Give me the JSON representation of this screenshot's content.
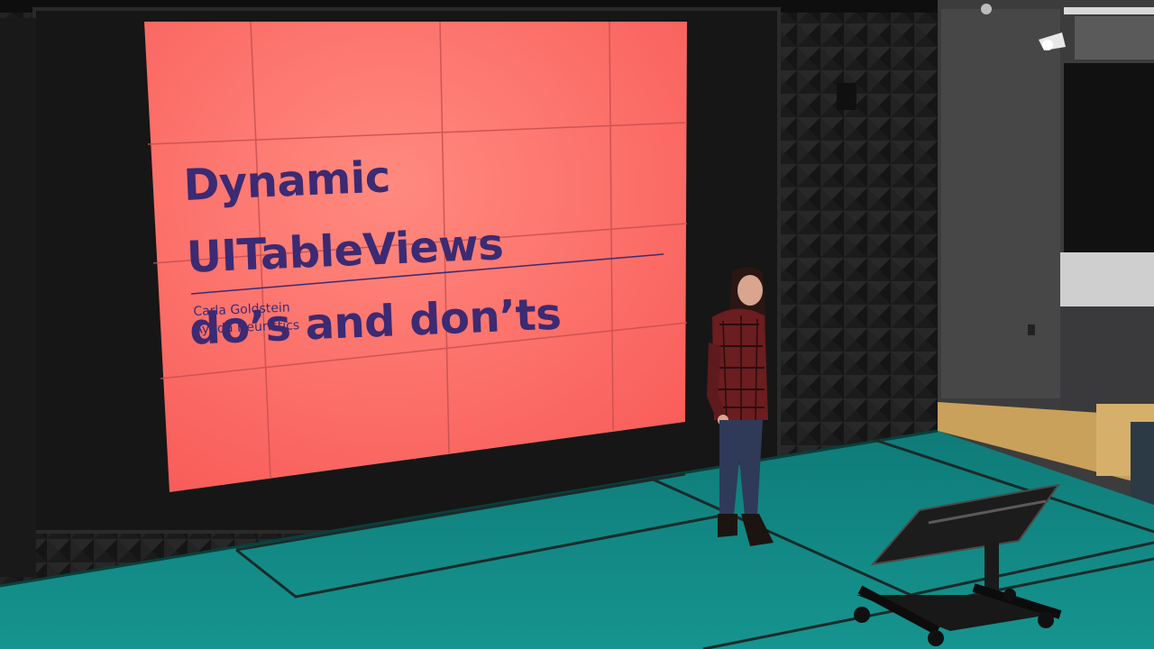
{
  "slide": {
    "title_line1": "Dynamic UITableViews",
    "title_line2": "do’s and don’ts",
    "author": "Carla Goldstein",
    "company": "Ayuda Heuristics"
  },
  "colors": {
    "slide_background": "#fb6c67",
    "slide_text": "#3c2a72",
    "floor": "#138c87",
    "wall": "#1d1d1d",
    "speaker_shirt": "#6b1d1f",
    "speaker_jeans": "#2e3a58"
  },
  "scene": {
    "setting": "stage",
    "elements": [
      "projection-wall",
      "acoustic-panels",
      "speaker",
      "teleprompter-stand",
      "camera-light",
      "side-room"
    ]
  }
}
